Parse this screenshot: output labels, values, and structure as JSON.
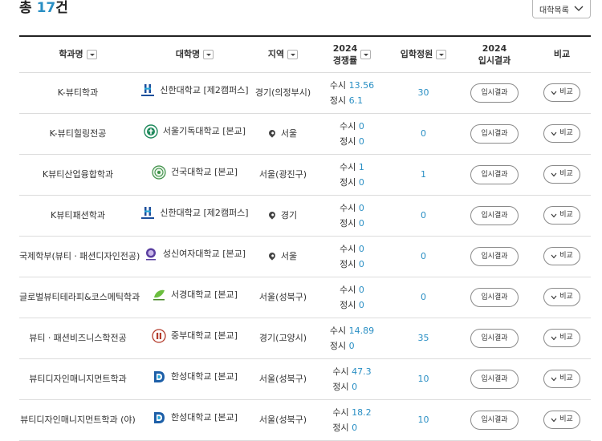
{
  "summary": {
    "prefix": "총",
    "count": "17",
    "suffix": "건"
  },
  "sort": {
    "label": "대학목록"
  },
  "headers": {
    "dept": "학과명",
    "univ": "대학명",
    "region": "지역",
    "comp_year": "2024",
    "comp_label": "경쟁률",
    "quota": "입학정원",
    "result_year": "2024",
    "result_label": "입시결과",
    "compare": "비교"
  },
  "row_buttons": {
    "result": "입시결과",
    "compare": "비교"
  },
  "rows": [
    {
      "dept": "K-뷰티학과",
      "univ": "신한대학교 [제2캠퍼스]",
      "logo": "shinhan-logo",
      "region": "경기(의정부시)",
      "pin": false,
      "susi_label": "수시",
      "susi": "13.56",
      "jeongsi_label": "정시",
      "jeongsi": "6.1",
      "quota": "30"
    },
    {
      "dept": "K-뷰티힐링전공",
      "univ": "서울기독대학교 [본교]",
      "logo": "seoul-christian-logo",
      "region": "서울",
      "pin": true,
      "susi_label": "수시",
      "susi": "0",
      "jeongsi_label": "정시",
      "jeongsi": "0",
      "quota": "0"
    },
    {
      "dept": "K뷰티산업융합학과",
      "univ": "건국대학교 [본교]",
      "logo": "konkuk-logo",
      "region": "서울(광진구)",
      "pin": false,
      "susi_label": "수시",
      "susi": "1",
      "jeongsi_label": "정시",
      "jeongsi": "0",
      "quota": "1"
    },
    {
      "dept": "K뷰티패션학과",
      "univ": "신한대학교 [제2캠퍼스]",
      "logo": "shinhan-logo",
      "region": "경기",
      "pin": true,
      "susi_label": "수시",
      "susi": "0",
      "jeongsi_label": "정시",
      "jeongsi": "0",
      "quota": "0"
    },
    {
      "dept": "국제학부(뷰티ㆍ패션디자인전공)",
      "univ": "성신여자대학교 [본교]",
      "logo": "sungshin-logo",
      "region": "서울",
      "pin": true,
      "susi_label": "수시",
      "susi": "0",
      "jeongsi_label": "정시",
      "jeongsi": "0",
      "quota": "0"
    },
    {
      "dept": "글로벌뷰티테라피&코스메틱학과",
      "univ": "서경대학교 [본교]",
      "logo": "seokyeong-logo",
      "region": "서울(성북구)",
      "pin": false,
      "susi_label": "수시",
      "susi": "0",
      "jeongsi_label": "정시",
      "jeongsi": "0",
      "quota": "0"
    },
    {
      "dept": "뷰티ㆍ패션비즈니스학전공",
      "univ": "중부대학교 [본교]",
      "logo": "joongbu-logo",
      "region": "경기(고양시)",
      "pin": false,
      "susi_label": "수시",
      "susi": "14.89",
      "jeongsi_label": "정시",
      "jeongsi": "0",
      "quota": "35"
    },
    {
      "dept": "뷰티디자인매니지먼트학과",
      "univ": "한성대학교 [본교]",
      "logo": "hansung-logo",
      "region": "서울(성북구)",
      "pin": false,
      "susi_label": "수시",
      "susi": "47.3",
      "jeongsi_label": "정시",
      "jeongsi": "0",
      "quota": "10"
    },
    {
      "dept": "뷰티디자인매니지먼트학과 (야)",
      "univ": "한성대학교 [본교]",
      "logo": "hansung-logo",
      "region": "서울(성북구)",
      "pin": false,
      "susi_label": "수시",
      "susi": "18.2",
      "jeongsi_label": "정시",
      "jeongsi": "0",
      "quota": "10"
    }
  ],
  "colors": {
    "accent": "#2a8fc4",
    "border": "#dcdcdc",
    "header_rule": "#222222"
  }
}
